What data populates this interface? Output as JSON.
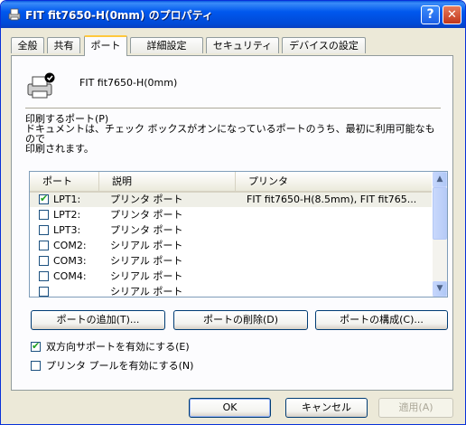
{
  "window": {
    "title": "FIT fit7650-H(0mm) のプロパティ",
    "help_button": "?",
    "close_button": "✕"
  },
  "tabs": [
    {
      "label": "全般",
      "active": false
    },
    {
      "label": "共有",
      "active": false
    },
    {
      "label": "ポート",
      "active": true
    },
    {
      "label": "詳細設定",
      "active": false
    },
    {
      "label": "セキュリティ",
      "active": false
    },
    {
      "label": "デバイスの設定",
      "active": false
    }
  ],
  "printer": {
    "name": "FIT fit7650-H(0mm)",
    "icon": "printer-icon"
  },
  "instructions": {
    "line1": "印刷するポート(P)",
    "line2": "ドキュメントは、チェック ボックスがオンになっているポートのうち、最初に利用可能なもので",
    "line3": "印刷されます。"
  },
  "port_list": {
    "columns": [
      "ポート",
      "説明",
      "プリンタ"
    ],
    "rows": [
      {
        "port": "LPT1:",
        "description": "プリンタ ポート",
        "printer": "FIT fit7650-H(8.5mm), FIT fit765...",
        "checked": true,
        "selected": true
      },
      {
        "port": "LPT2:",
        "description": "プリンタ ポート",
        "printer": "",
        "checked": false,
        "selected": false
      },
      {
        "port": "LPT3:",
        "description": "プリンタ ポート",
        "printer": "",
        "checked": false,
        "selected": false
      },
      {
        "port": "COM2:",
        "description": "シリアル ポート",
        "printer": "",
        "checked": false,
        "selected": false
      },
      {
        "port": "COM3:",
        "description": "シリアル ポート",
        "printer": "",
        "checked": false,
        "selected": false
      },
      {
        "port": "COM4:",
        "description": "シリアル ポート",
        "printer": "",
        "checked": false,
        "selected": false
      },
      {
        "port": "",
        "description": "シリアル ポート",
        "printer": "",
        "checked": false,
        "selected": false
      }
    ]
  },
  "port_buttons": {
    "add": "ポートの追加(T)...",
    "delete": "ポートの削除(D)",
    "configure": "ポートの構成(C)..."
  },
  "options": {
    "bidirectional": {
      "label": "双方向サポートを有効にする(E)",
      "checked": true
    },
    "pooling": {
      "label": "プリンタ プールを有効にする(N)",
      "checked": false
    }
  },
  "dialog_buttons": {
    "ok": "OK",
    "cancel": "キャンセル",
    "apply": "適用(A)"
  },
  "colors": {
    "titlebar": "#0058ee",
    "face": "#ece9d8",
    "active_tab_accent": "#ffc83c",
    "checkmark": "#21a121"
  }
}
